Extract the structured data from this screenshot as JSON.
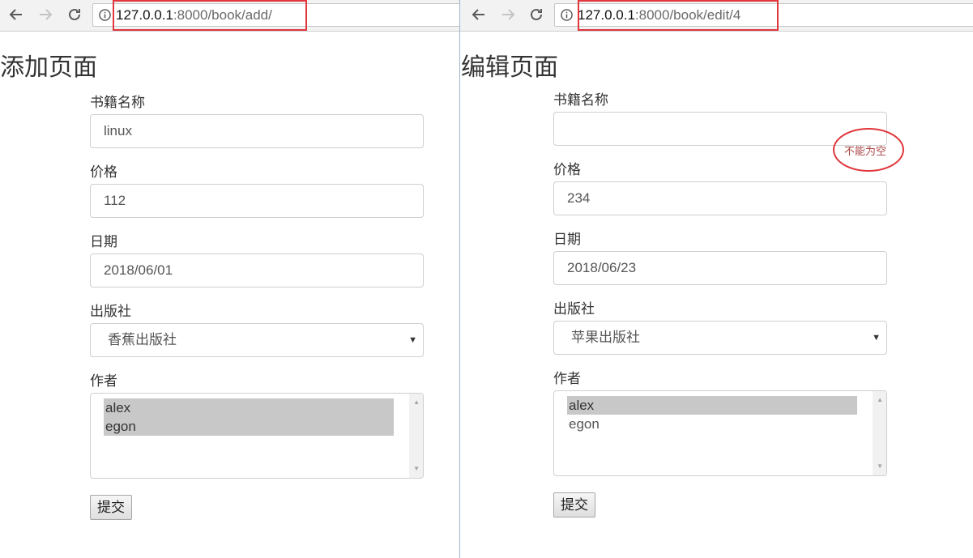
{
  "left": {
    "url": {
      "host": "127.0.0.1",
      "path": ":8000/book/add/"
    },
    "title": "添加页面",
    "form": {
      "labels": {
        "name": "书籍名称",
        "price": "价格",
        "date": "日期",
        "publisher": "出版社",
        "authors": "作者"
      },
      "values": {
        "name": "linux",
        "price": "112",
        "date": "2018/06/01",
        "publisher": "香蕉出版社"
      },
      "authors": [
        {
          "label": "alex",
          "selected": true
        },
        {
          "label": "egon",
          "selected": true
        }
      ],
      "submit_label": "提交"
    }
  },
  "right": {
    "url": {
      "host": "127.0.0.1",
      "path": ":8000/book/edit/4"
    },
    "title": "编辑页面",
    "form": {
      "labels": {
        "name": "书籍名称",
        "price": "价格",
        "date": "日期",
        "publisher": "出版社",
        "authors": "作者"
      },
      "values": {
        "name": "",
        "price": "234",
        "date": "2018/06/23",
        "publisher": "苹果出版社"
      },
      "name_error": "不能为空",
      "authors": [
        {
          "label": "alex",
          "selected": true
        },
        {
          "label": "egon",
          "selected": false
        }
      ],
      "submit_label": "提交"
    }
  },
  "colors": {
    "annotation_red": "#e0363c",
    "error_text": "#a94442",
    "selected_option": "#c8c8c8"
  }
}
